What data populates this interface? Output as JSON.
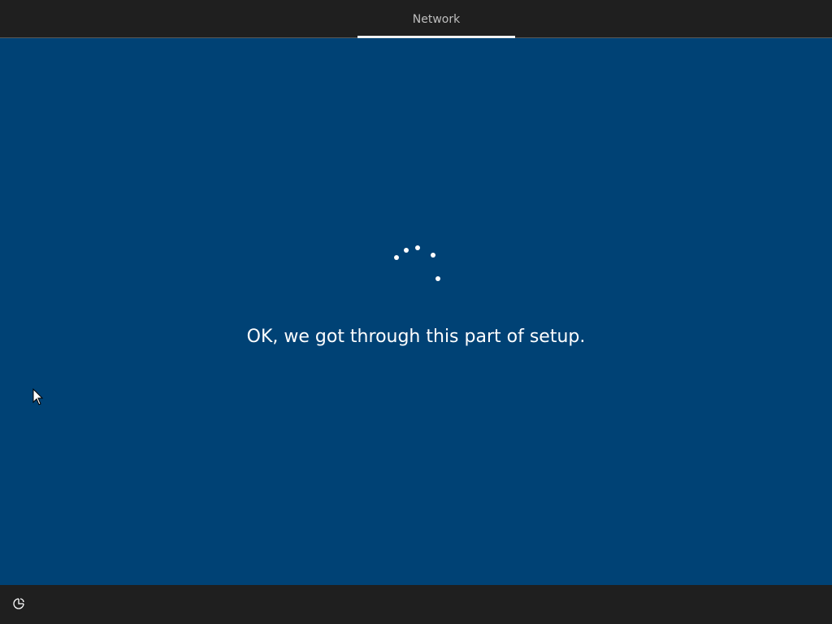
{
  "header": {
    "tabs": [
      {
        "label": "Network",
        "active": true
      }
    ]
  },
  "main": {
    "message": "OK, we got through this part of setup.",
    "spinner_icon": "loading-spinner-icon"
  },
  "footer": {
    "accessibility_icon": "ease-of-access-icon"
  },
  "colors": {
    "background": "#004275",
    "bar": "#1f1f1f",
    "text": "#ffffff",
    "tab_text": "#bfbfbf"
  }
}
